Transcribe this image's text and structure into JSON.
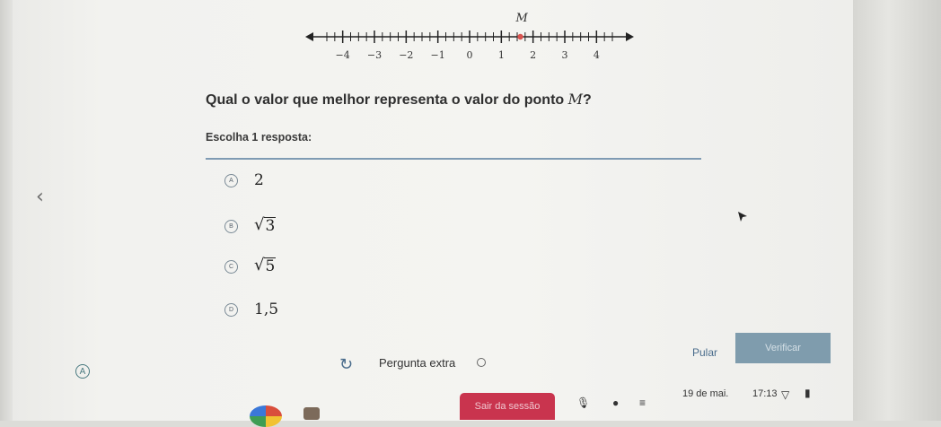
{
  "number_line": {
    "point_label": "M",
    "point_value": 1.6,
    "range": [
      -4.75,
      4.75
    ],
    "tick_step": 0.25,
    "labeled_ticks": [
      "−4",
      "−3",
      "−2",
      "−1",
      "0",
      "1",
      "2",
      "3",
      "4"
    ],
    "point_color": "#d9534f"
  },
  "question": {
    "text_before": "Qual o valor que melhor representa o valor do ponto ",
    "variable": "M",
    "text_after": "?"
  },
  "instruction": "Escolha 1 resposta:",
  "options": [
    {
      "letter": "A",
      "value": "2"
    },
    {
      "letter": "B",
      "radicand": "3"
    },
    {
      "letter": "C",
      "radicand": "5"
    },
    {
      "letter": "D",
      "value": "1,5"
    }
  ],
  "footer": {
    "extra_label": "Pergunta extra",
    "skip_label": "Pular",
    "verify_label": "Verificar",
    "corner_letter": "A"
  },
  "taskbar": {
    "logout_label": "Sair da sessão",
    "date": "19 de mai.",
    "time": "17:13"
  },
  "icons": {
    "back": "chevron-left",
    "extra": "refresh-arc",
    "cursor": "mouse-pointer"
  },
  "colors": {
    "accent": "#7f9cad",
    "logout": "#c9344e",
    "divider": "#7f9bb3"
  }
}
